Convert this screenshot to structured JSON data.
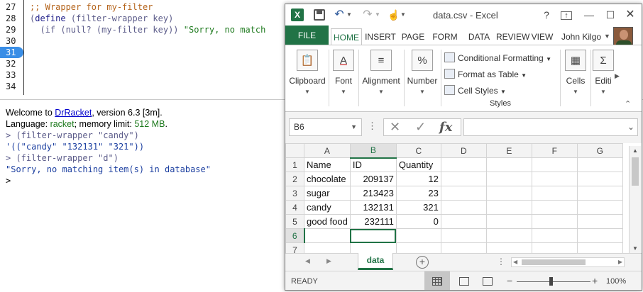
{
  "editor": {
    "line_numbers": [
      "27",
      "28",
      "29",
      "30",
      "31",
      "32",
      "33",
      "34"
    ],
    "current_line": "31",
    "code": {
      "l27": ";; Wrapper for my-filter",
      "l28_open": "(",
      "l28_kw": "define",
      "l28_rest": " (filter-wrapper key)",
      "l29_lead": "  (if (null? (my-filter key)) ",
      "l29_str": "\"Sorry, no match"
    }
  },
  "repl": {
    "welcome_prefix": "Welcome to ",
    "welcome_link": "DrRacket",
    "welcome_suffix": ", version 6.3 [3m].",
    "language_prefix": "Language: ",
    "language_name": "racket",
    "language_mid": "; memory limit: ",
    "memory_limit": "512 MB",
    "language_end": ".",
    "prompt1": "> (filter-wrapper \"candy\")",
    "output1": "'((\"candy\" \"132131\" \"321\"))",
    "prompt2": "> (filter-wrapper \"d\")",
    "output2": "\"Sorry, no matching item(s) in database\"",
    "prompt3": ">"
  },
  "excel": {
    "title": "data.csv - Excel",
    "tabs": {
      "file": "FILE",
      "home": "HOME",
      "insert": "INSERT",
      "page_layout": "PAGE L",
      "formulas": "FORM",
      "data": "DATA",
      "review": "REVIEW",
      "view": "VIEW"
    },
    "user": "John Kilgo",
    "ribbon": {
      "clipboard": "Clipboard",
      "font": "Font",
      "alignment": "Alignment",
      "number": "Number",
      "conditional_formatting": "Conditional Formatting",
      "format_as_table": "Format as Table",
      "cell_styles": "Cell Styles",
      "styles_group": "Styles",
      "cells": "Cells",
      "editing": "Editi"
    },
    "name_box": "B6",
    "formula_value": "",
    "columns": [
      "A",
      "B",
      "C",
      "D",
      "E",
      "F",
      "G"
    ],
    "rows": [
      {
        "num": "1",
        "a": "Name",
        "b": "ID",
        "c": "Quantity"
      },
      {
        "num": "2",
        "a": "chocolate",
        "b": "209137",
        "c": "12"
      },
      {
        "num": "3",
        "a": "sugar",
        "b": "213423",
        "c": "23"
      },
      {
        "num": "4",
        "a": "candy",
        "b": "132131",
        "c": "321"
      },
      {
        "num": "5",
        "a": "good food",
        "b": "232111",
        "c": "0"
      },
      {
        "num": "6",
        "a": "",
        "b": "",
        "c": ""
      },
      {
        "num": "7",
        "a": "",
        "b": "",
        "c": ""
      }
    ],
    "sheet_name": "data",
    "status": "READY",
    "zoom": "100%"
  }
}
